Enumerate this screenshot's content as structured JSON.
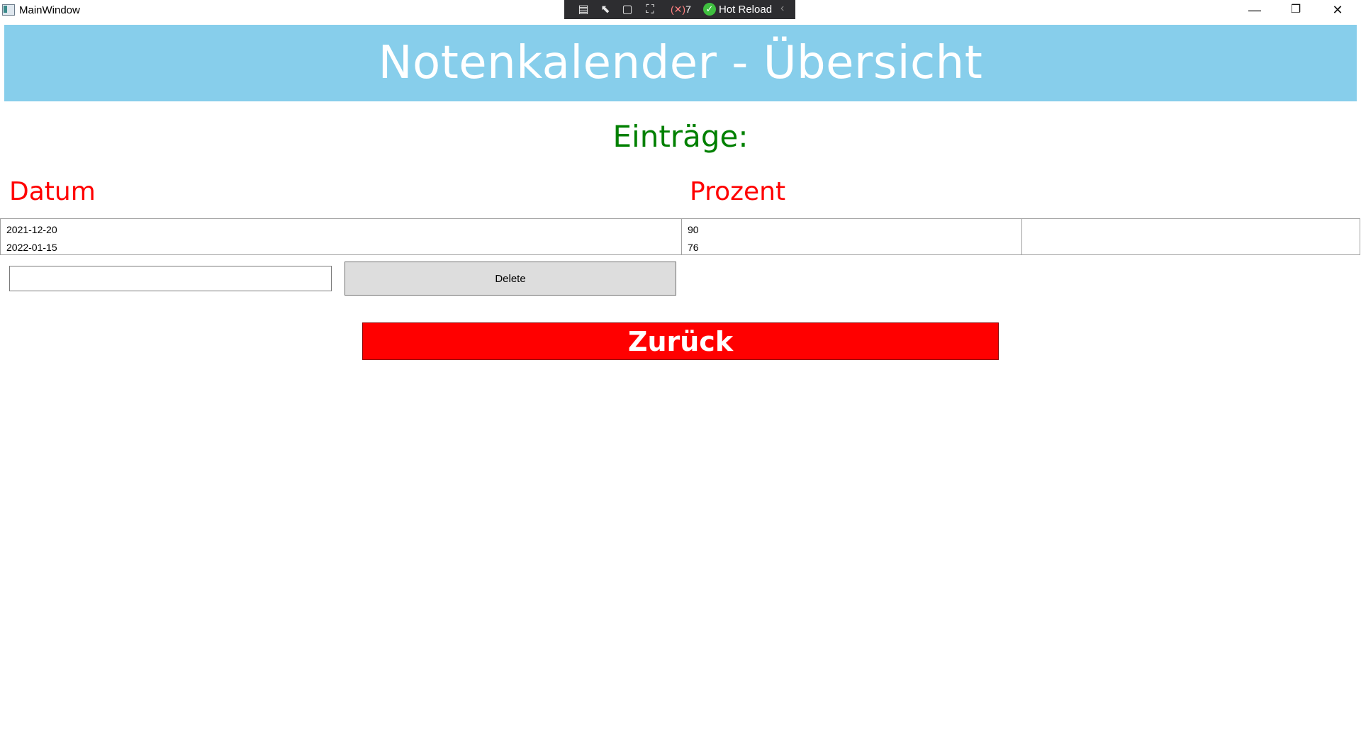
{
  "window": {
    "title": "MainWindow",
    "controls": {
      "minimize": "—",
      "restore": "❐",
      "close": "✕"
    }
  },
  "devbar": {
    "badge_count": "7",
    "hot_reload": "Hot Reload",
    "collapse": "‹"
  },
  "header": {
    "title": "Notenkalender - Übersicht",
    "background": "#87ceeb"
  },
  "entries_label": "Einträge:",
  "columns": {
    "date": "Datum",
    "percent": "Prozent"
  },
  "table": {
    "rows": [
      {
        "date": "2021-12-20",
        "percent": "90"
      },
      {
        "date": "2022-01-15",
        "percent": "76"
      }
    ]
  },
  "input": {
    "value": ""
  },
  "delete_button": {
    "label": "Delete"
  },
  "back_button": {
    "label": "Zurück",
    "background": "#ff0000"
  }
}
